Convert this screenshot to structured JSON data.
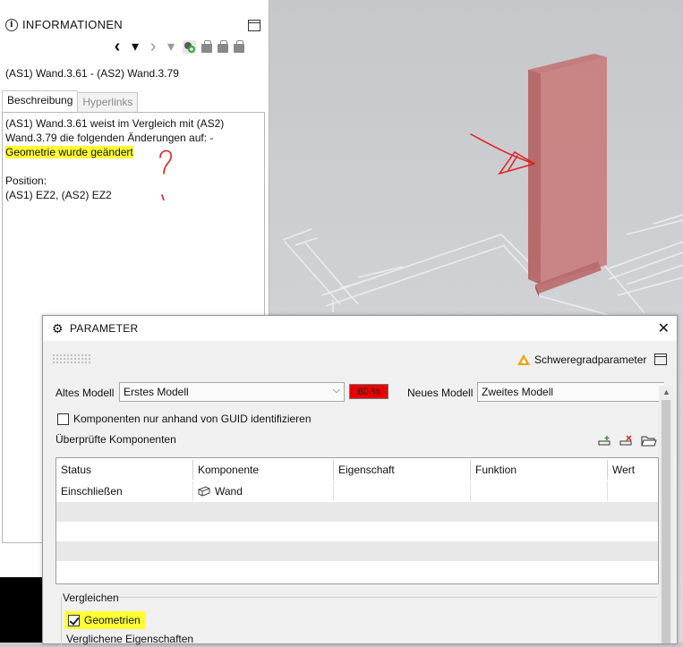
{
  "info_panel": {
    "title": "INFORMATIONEN",
    "component_title": "(AS1) Wand.3.61 - (AS2) Wand.3.79",
    "tabs": [
      "Beschreibung",
      "Hyperlinks"
    ],
    "description": {
      "line1": "(AS1) Wand.3.61 weist im Vergleich mit (AS2)",
      "line2": "Wand.3.79 die folgenden Änderungen auf: -",
      "line3_highlighted": "Geometrie wurde geändert",
      "position_label": "Position:",
      "position_value": "(AS1) EZ2, (AS2) EZ2"
    },
    "nav": {
      "prev": "‹",
      "dropdown": "▾",
      "next": "›",
      "dropdown_disabled": "▾"
    }
  },
  "param_window": {
    "title": "PARAMETER",
    "close": "✕",
    "schweregrad": "Schweregradparameter",
    "altes_modell_label": "Altes Modell",
    "altes_modell_value": "Erstes Modell",
    "match_percent": "60 %",
    "neues_modell_label": "Neues Modell",
    "neues_modell_value": "Zweites Modell",
    "guid_checkbox_label": "Komponenten nur anhand von GUID identifizieren",
    "checked_components_label": "Überprüfte Komponenten",
    "table": {
      "columns": [
        "Status",
        "Komponente",
        "Eigenschaft",
        "Funktion",
        "Wert"
      ],
      "rows": [
        {
          "status": "Einschließen",
          "komponente": "Wand",
          "eigenschaft": "",
          "funktion": "",
          "wert": ""
        }
      ]
    },
    "compare_group_label": "Vergleichen",
    "geometry_checkbox_label": "Geometrien",
    "compared_properties_label": "Verglichene Eigenschaften"
  },
  "colors": {
    "highlight": "#ffff33",
    "wall": "#c06a6a",
    "percent_bg": "#e60000",
    "annotation": "#e02020"
  }
}
